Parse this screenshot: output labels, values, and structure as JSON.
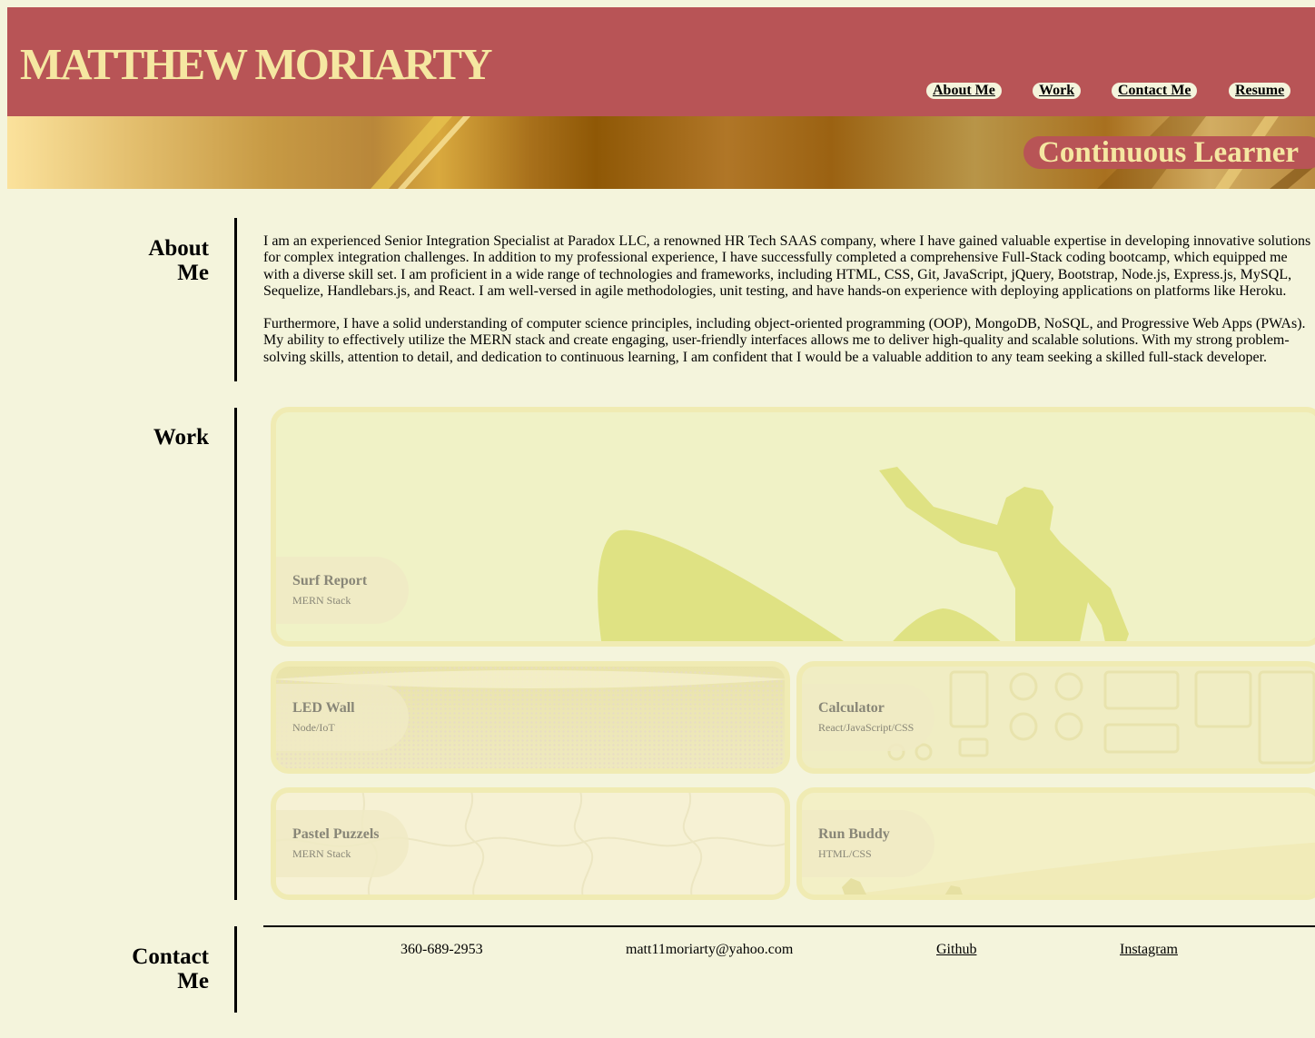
{
  "header": {
    "title": "MATTHEW MORIARTY",
    "nav": [
      {
        "label": "About Me"
      },
      {
        "label": "Work"
      },
      {
        "label": "Contact Me"
      },
      {
        "label": "Resume"
      }
    ]
  },
  "banner": {
    "tagline": "Continuous Learner"
  },
  "about": {
    "heading_line1": "About",
    "heading_line2": "Me",
    "paragraphs": [
      "I am an experienced Senior Integration Specialist at Paradox LLC, a renowned HR Tech SAAS company, where I have gained valuable expertise in developing innovative solutions for complex integration challenges. In addition to my professional experience, I have successfully completed a comprehensive Full-Stack coding bootcamp, which equipped me with a diverse skill set. I am proficient in a wide range of technologies and frameworks, including HTML, CSS, Git, JavaScript, jQuery, Bootstrap, Node.js, Express.js, MySQL, Sequelize, Handlebars.js, and React. I am well-versed in agile methodologies, unit testing, and have hands-on experience with deploying applications on platforms like Heroku.",
      "Furthermore, I have a solid understanding of computer science principles, including object-oriented programming (OOP), MongoDB, NoSQL, and Progressive Web Apps (PWAs). My ability to effectively utilize the MERN stack and create engaging, user-friendly interfaces allows me to deliver high-quality and scalable solutions. With my strong problem-solving skills, attention to detail, and dedication to continuous learning, I am confident that I would be a valuable addition to any team seeking a skilled full-stack developer."
    ]
  },
  "work": {
    "heading": "Work",
    "projects": [
      {
        "title": "Surf Report",
        "stack": "MERN Stack"
      },
      {
        "title": "LED Wall",
        "stack": "Node/IoT"
      },
      {
        "title": "Calculator",
        "stack": "React/JavaScript/CSS"
      },
      {
        "title": "Pastel Puzzels",
        "stack": "MERN Stack"
      },
      {
        "title": "Run Buddy",
        "stack": "HTML/CSS"
      }
    ]
  },
  "contact": {
    "heading_line1": "Contact",
    "heading_line2": "Me",
    "phone": "360-689-2953",
    "email": "matt11moriarty@yahoo.com",
    "github": "Github",
    "instagram": "Instagram"
  },
  "colors": {
    "header_bg": "#b85456",
    "title_color": "#f5e7a1",
    "page_bg": "#f4f4dc"
  }
}
